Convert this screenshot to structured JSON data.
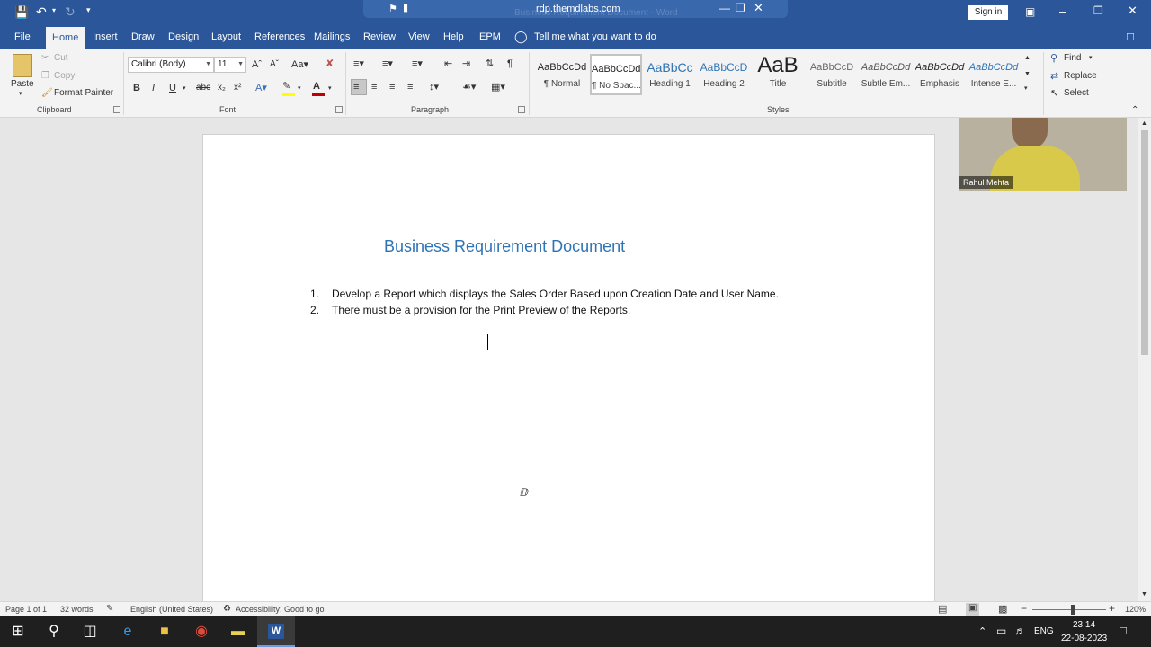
{
  "titlebar": {
    "remote_host": "rdp.themdlabs.com",
    "faded_title": "Business Requirement Document - Word",
    "sign_in": "Sign in"
  },
  "tabs": [
    "File",
    "Home",
    "Insert",
    "Draw",
    "Design",
    "Layout",
    "References",
    "Mailings",
    "Review",
    "View",
    "Help",
    "EPM"
  ],
  "tell_me": "Tell me what you want to do",
  "clipboard": {
    "paste": "Paste",
    "cut": "Cut",
    "copy": "Copy",
    "format_painter": "Format Painter",
    "label": "Clipboard"
  },
  "font": {
    "family": "Calibri (Body)",
    "size": "11",
    "label": "Font"
  },
  "paragraph": {
    "label": "Paragraph"
  },
  "styles": {
    "label": "Styles",
    "items": [
      {
        "preview": "AaBbCcDd",
        "name": "¶ Normal"
      },
      {
        "preview": "AaBbCcDd",
        "name": "¶ No Spac..."
      },
      {
        "preview": "AaBbCc",
        "name": "Heading 1"
      },
      {
        "preview": "AaBbCcD",
        "name": "Heading 2"
      },
      {
        "preview": "AaB",
        "name": "Title"
      },
      {
        "preview": "AaBbCcD",
        "name": "Subtitle"
      },
      {
        "preview": "AaBbCcDd",
        "name": "Subtle Em..."
      },
      {
        "preview": "AaBbCcDd",
        "name": "Emphasis"
      },
      {
        "preview": "AaBbCcDd",
        "name": "Intense E..."
      }
    ]
  },
  "editing": {
    "find": "Find",
    "replace": "Replace",
    "select": "Select"
  },
  "video": {
    "name": "Rahul Mehta"
  },
  "document": {
    "title": "Business Requirement Document",
    "items": [
      {
        "num": "1.",
        "text": "Develop a Report which displays the Sales Order Based upon Creation Date and User Name."
      },
      {
        "num": "2.",
        "text": "There must be a provision for the Print Preview of the Reports."
      }
    ]
  },
  "status": {
    "page": "Page 1 of 1",
    "words": "32 words",
    "language": "English (United States)",
    "accessibility": "Accessibility: Good to go",
    "zoom": "120%",
    "zoom_fraction": 0.55
  },
  "taskbar": {
    "lang": "ENG",
    "time": "23:14",
    "date": "22-08-2023"
  },
  "colors": {
    "accent": "#2b579a",
    "heading": "#2e74b5",
    "taskbar": "#1f1f1f"
  }
}
